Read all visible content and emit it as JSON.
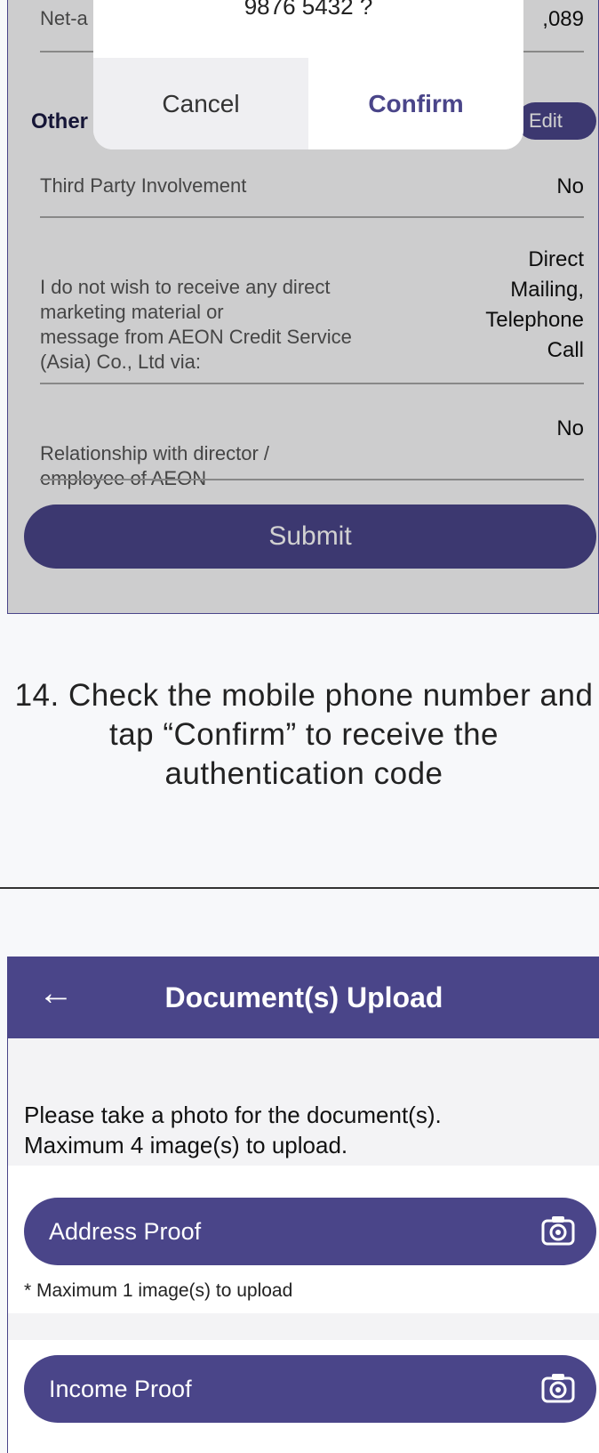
{
  "review_screen": {
    "netamount_label_fragment": "Net-a",
    "netamount_value_fragment": ",089",
    "others_label": "Other",
    "edit_label": "Edit",
    "rows": [
      {
        "label": "Third Party Involvement",
        "value": "No"
      },
      {
        "label": "I do not wish to receive any direct\nmarketing material or\n message from AEON Credit Service\n(Asia) Co., Ltd via:",
        "value": "Direct\nMailing,\nTelephone\nCall"
      },
      {
        "label": "Relationship with director /\nemployee of AEON",
        "value": "No"
      }
    ],
    "submit_label": "Submit"
  },
  "dialog": {
    "phone_text": "9876 5432 ?",
    "cancel_label": "Cancel",
    "confirm_label": "Confirm"
  },
  "caption": "14. Check the mobile phone number and tap “Confirm” to receive the authentication code",
  "upload_screen": {
    "title": "Document(s) Upload",
    "back_icon": "←",
    "instruction": "Please take a photo for the document(s).\nMaximum 4 image(s) to upload.",
    "items": [
      {
        "label": "Address Proof",
        "note": "* Maximum 1 image(s) to upload"
      },
      {
        "label": "Income Proof",
        "note": ""
      }
    ],
    "icon": "camera-icon"
  },
  "colors": {
    "accent": "#4a4589"
  }
}
